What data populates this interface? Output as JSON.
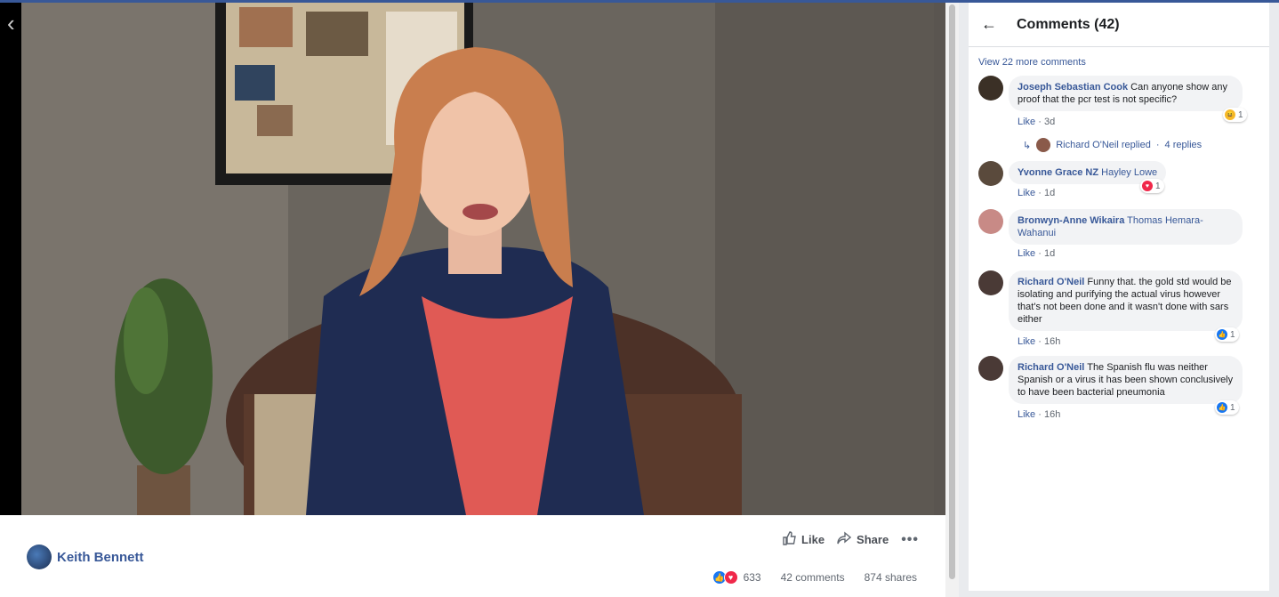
{
  "video": {
    "prev_icon": "chevron-left-icon"
  },
  "post": {
    "author": "Keith Bennett",
    "actions": {
      "like": "Like",
      "share": "Share",
      "more": "•••"
    },
    "stats": {
      "reactions": "633",
      "comments": "42 comments",
      "shares": "874 shares"
    }
  },
  "panel": {
    "title": "Comments (42)",
    "view_more": "View 22 more comments",
    "comments": [
      {
        "name": "Joseph Sebastian Cook",
        "text": "Can anyone show any proof that the pcr test is not specific?",
        "like": "Like",
        "time": "3d",
        "reaction_count": "1",
        "reaction": "haha",
        "reply": {
          "text": "Richard O'Neil replied",
          "count": "4 replies"
        }
      },
      {
        "name": "Yvonne Grace NZ",
        "tag": "Hayley Lowe",
        "like": "Like",
        "time": "1d",
        "reaction_count": "1",
        "reaction": "love"
      },
      {
        "name": "Bronwyn-Anne Wikaira",
        "tag": "Thomas Hemara-Wahanui",
        "like": "Like",
        "time": "1d"
      },
      {
        "name": "Richard O'Neil",
        "text": "Funny that. the gold std would be isolating and purifying the actual virus however that's not been done and it wasn't done with sars either",
        "like": "Like",
        "time": "16h",
        "reaction_count": "1",
        "reaction": "like"
      },
      {
        "name": "Richard O'Neil",
        "text": "The Spanish flu was neither Spanish or a virus it has been shown conclusively to have been bacterial pneumonia",
        "like": "Like",
        "time": "16h",
        "reaction_count": "1",
        "reaction": "like"
      }
    ]
  },
  "colors": {
    "link": "#385898",
    "like_blue": "#1877f2",
    "love_red": "#f0284a",
    "haha_yellow": "#f7b928"
  }
}
